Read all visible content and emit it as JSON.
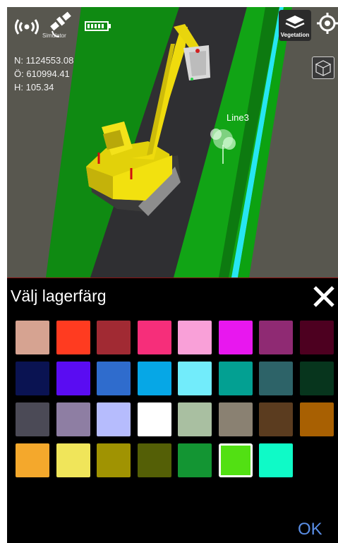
{
  "status_bar": {
    "signal_icon": "signal-icon",
    "satellite_icon": "satellite-icon",
    "satellite_label": "Simulator",
    "battery_icon": "battery-icon"
  },
  "coordinates": {
    "north": "N: 1124553.08",
    "east": "Ö: 610994.41",
    "height": "H: 105.34"
  },
  "toolbar": {
    "vegetation_label": "Vegetation",
    "vegetation_icon": "layers-icon",
    "location_icon": "crosshair-icon",
    "cube_icon": "cube-icon"
  },
  "scene": {
    "line_label": "Line3"
  },
  "dialog": {
    "title": "Välj lagerfärg",
    "close_icon": "close-icon",
    "ok_label": "OK",
    "selected_color": "#52e013",
    "colors": [
      [
        "#d6a391",
        "#ff3b20",
        "#a12a33",
        "#f62e7a",
        "#f9a0d8",
        "#e817ef",
        "#8f2a73",
        "#4d0020"
      ],
      [
        "#0a1352",
        "#5a0cf2",
        "#2f6ccd",
        "#06a7e6",
        "#72ecfb",
        "#03a092",
        "#2d6368",
        "#07351d"
      ],
      [
        "#4b4a56",
        "#8e7ea3",
        "#b6bcfd",
        "#ffffff",
        "#a9bfa1",
        "#8a8172",
        "#5b3c1f",
        "#a86002"
      ],
      [
        "#f4a82c",
        "#f0e55a",
        "#a09302",
        "#545f06",
        "#139533",
        "#52e013",
        "#0ffac7"
      ]
    ]
  }
}
